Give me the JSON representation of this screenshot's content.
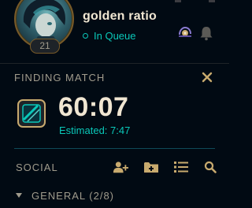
{
  "profile": {
    "summoner_name": "golden ratio",
    "level": "21",
    "status": "In Queue",
    "avatar_icon": "champion-portrait",
    "status_color": "#0ac8b9"
  },
  "header_icons": {
    "emblem_icon": "mythic-emblem-icon",
    "notifications_icon": "bell-icon"
  },
  "finding_match": {
    "title": "FINDING MATCH",
    "timer": "60:07",
    "estimated_label": "Estimated:",
    "estimated_value": "7:47",
    "close_icon": "close-icon",
    "queue_icon": "queue-emblem-icon"
  },
  "social": {
    "title": "SOCIAL",
    "actions": [
      {
        "icon": "add-friend-icon"
      },
      {
        "icon": "add-folder-icon"
      },
      {
        "icon": "list-icon"
      },
      {
        "icon": "search-icon"
      }
    ],
    "groups": [
      {
        "name": "GENERAL",
        "count": "(2/8)",
        "expanded": true
      }
    ]
  },
  "colors": {
    "background": "#010a13",
    "gold_text": "#f0e6d2",
    "muted_text": "#a09b8c",
    "teal": "#0ac8b9",
    "gold_border": "#785a28"
  }
}
